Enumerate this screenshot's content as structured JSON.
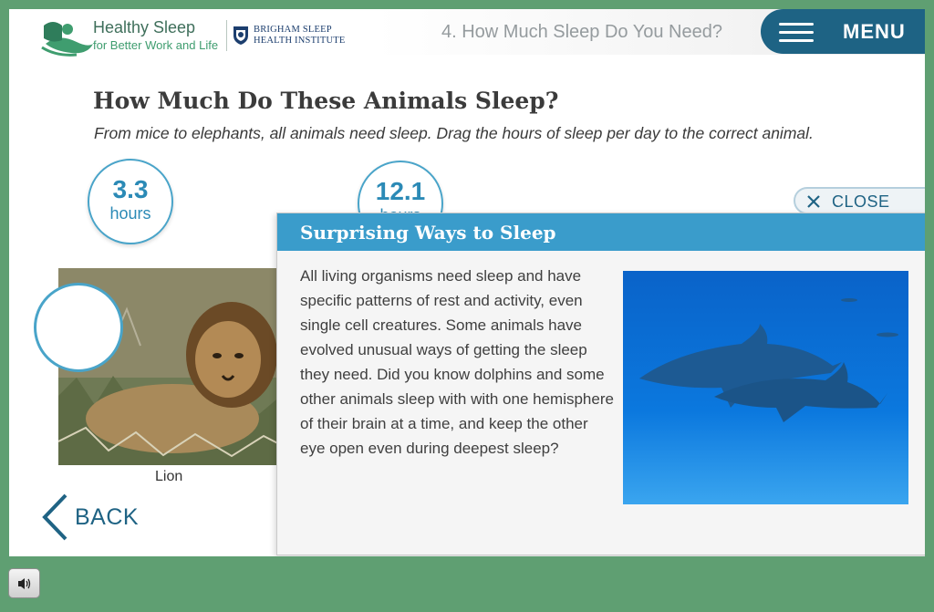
{
  "header": {
    "brand_line1": "Healthy Sleep",
    "brand_line2": "for Better Work and Life",
    "institute_line1": "BRIGHAM SLEEP",
    "institute_line2": "HEALTH INSTITUTE",
    "section_title": "4. How Much Sleep Do You Need?",
    "menu_label": "MENU"
  },
  "main": {
    "heading": "How Much Do These Animals Sleep?",
    "instructions": "From mice to elephants, all animals need sleep. Drag the hours of sleep per day to the correct animal.",
    "hour_chips": [
      {
        "value": "3.3",
        "unit": "hours"
      },
      {
        "value": "12.1",
        "unit": "hours"
      }
    ],
    "animal_label": "Lion",
    "back_label": "BACK"
  },
  "popup": {
    "close_label": "CLOSE",
    "title": "Surprising Ways to Sleep",
    "body": "All living organisms need sleep and have specific patterns of rest and activity, even single cell creatures. Some animals have evolved unusual ways of getting the sleep they need. Did you know dolphins and some other animals sleep with with one hemisphere of their brain at a time, and keep the other eye open even during deepest sleep?"
  },
  "colors": {
    "accent": "#1e6384",
    "popup_title_bar": "#3a9ccb",
    "chip_border": "#49a4c9",
    "background": "#5f9f72"
  },
  "icons": [
    "healthy-sleep-logo-icon",
    "bwh-shield-icon",
    "hamburger-menu-icon",
    "close-icon",
    "chevron-left-icon",
    "speaker-icon"
  ]
}
